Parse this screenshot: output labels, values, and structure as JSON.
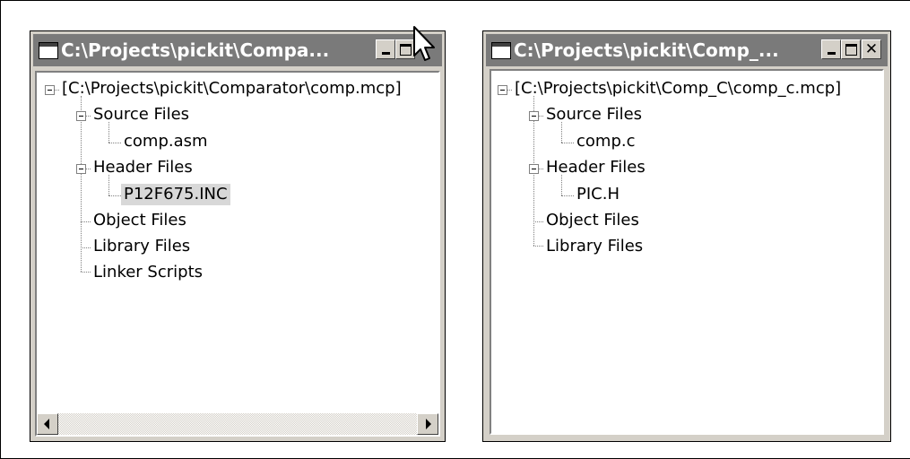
{
  "windows": [
    {
      "title": "C:\\Projects\\pickit\\Compa...",
      "project": "[C:\\Projects\\pickit\\Comparator\\comp.mcp]",
      "source_label": "Source Files",
      "source_file": "comp.asm",
      "header_label": "Header Files",
      "header_file": "P12F675.INC",
      "object_label": "Object Files",
      "library_label": "Library Files",
      "linker_label": "Linker Scripts"
    },
    {
      "title": "C:\\Projects\\pickit\\Comp_...",
      "project": "[C:\\Projects\\pickit\\Comp_C\\comp_c.mcp]",
      "source_label": "Source Files",
      "source_file": "comp.c",
      "header_label": "Header Files",
      "header_file": "PIC.H",
      "object_label": "Object Files",
      "library_label": "Library Files"
    }
  ],
  "icons": {
    "system_menu": "window-icon",
    "minimize": "minimize-icon",
    "maximize": "maximize-icon",
    "close": "close-icon",
    "cursor": "mouse-pointer-icon",
    "collapse": "minus-box-icon",
    "scroll_left": "arrow-left-icon",
    "scroll_right": "arrow-right-icon"
  },
  "colors": {
    "titlebar": "#7a7a7a",
    "window_face": "#d4d0c8",
    "selection": "#d8d8d8"
  }
}
